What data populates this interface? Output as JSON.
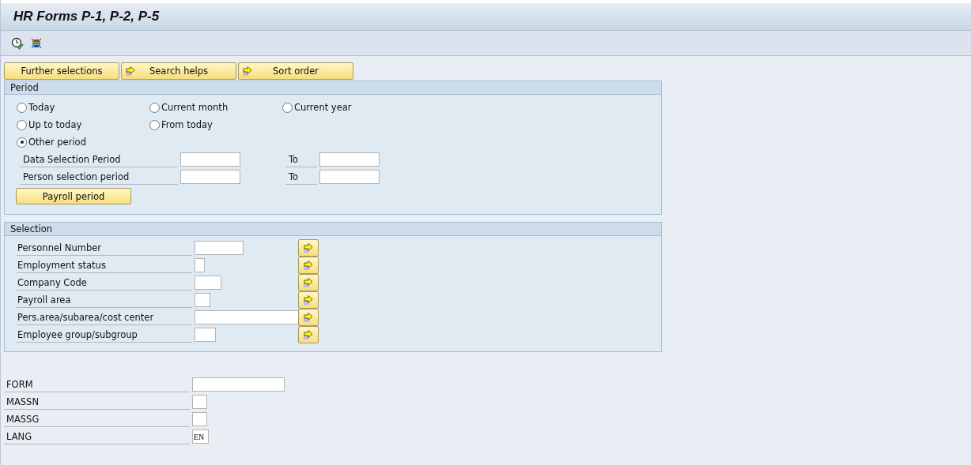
{
  "window": {
    "title": "HR Forms P-1, P-2, P-5"
  },
  "toolbar": {
    "buttons": [
      {
        "kind": "execute"
      },
      {
        "kind": "variants"
      }
    ]
  },
  "top_buttons": [
    {
      "label": "Further selections",
      "arrow": false
    },
    {
      "label": "Search helps",
      "arrow": true
    },
    {
      "label": "Sort order",
      "arrow": true
    }
  ],
  "period": {
    "title": "Period",
    "option_rows": [
      {
        "options": [
          {
            "label": "Today",
            "selected": false
          },
          {
            "label": "Current month",
            "selected": false
          },
          {
            "label": "Current year",
            "selected": false
          }
        ]
      },
      {
        "options": [
          {
            "label": "Up to today",
            "selected": false
          },
          {
            "label": "From today",
            "selected": false
          }
        ]
      },
      {
        "options": [
          {
            "label": "Other period",
            "selected": true
          }
        ]
      }
    ],
    "ranges": [
      {
        "label": "Data Selection Period",
        "to_label": "To"
      },
      {
        "label": "Person selection period",
        "to_label": "To"
      }
    ],
    "button": "Payroll period"
  },
  "selection": {
    "title": "Selection",
    "fields": [
      {
        "label": "Personnel Number"
      },
      {
        "label": "Employment status"
      },
      {
        "label": "Company Code"
      },
      {
        "label": "Payroll area"
      },
      {
        "label": "Pers.area/subarea/cost center"
      },
      {
        "label": "Employee group/subgroup"
      }
    ]
  },
  "parameters": [
    {
      "label": "FORM"
    },
    {
      "label": "MASSN"
    },
    {
      "label": "MASSG"
    },
    {
      "label": "LANG",
      "value": "EN"
    }
  ]
}
